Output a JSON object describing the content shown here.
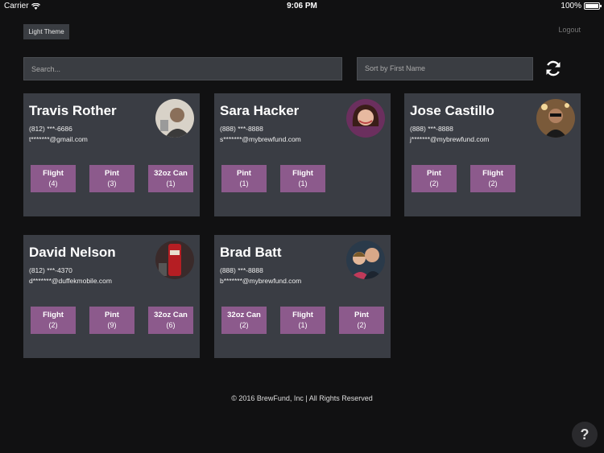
{
  "status": {
    "carrier": "Carrier",
    "time": "9:06 PM",
    "battery": "100%"
  },
  "header": {
    "theme_button": "Light Theme",
    "logout": "Logout"
  },
  "search": {
    "placeholder": "Search...",
    "sort_label": "Sort by First Name"
  },
  "cards": [
    {
      "name": "Travis Rother",
      "phone": "(812) ***-6686",
      "email": "t*******@gmail.com",
      "avatar_color": "#5a5a55",
      "drinks": [
        {
          "label": "Flight",
          "count": "(4)"
        },
        {
          "label": "Pint",
          "count": "(3)"
        },
        {
          "label": "32oz Can",
          "count": "(1)"
        }
      ]
    },
    {
      "name": "Sara Hacker",
      "phone": "(888) ***-8888",
      "email": "s*******@mybrewfund.com",
      "avatar_color": "#7a3a6a",
      "drinks": [
        {
          "label": "Pint",
          "count": "(1)"
        },
        {
          "label": "Flight",
          "count": "(1)"
        }
      ]
    },
    {
      "name": "Jose Castillo",
      "phone": "(888) ***-8888",
      "email": "j*******@mybrewfund.com",
      "avatar_color": "#6a5040",
      "drinks": [
        {
          "label": "Pint",
          "count": "(2)"
        },
        {
          "label": "Flight",
          "count": "(2)"
        }
      ]
    },
    {
      "name": "David Nelson",
      "phone": "(812) ***-4370",
      "email": "d*******@duffekmobile.com",
      "avatar_color": "#7a2a2a",
      "drinks": [
        {
          "label": "Flight",
          "count": "(2)"
        },
        {
          "label": "Pint",
          "count": "(9)"
        },
        {
          "label": "32oz Can",
          "count": "(6)"
        }
      ]
    },
    {
      "name": "Brad Batt",
      "phone": "(888) ***-8888",
      "email": "b*******@mybrewfund.com",
      "avatar_color": "#3a4a5a",
      "drinks": [
        {
          "label": "32oz Can",
          "count": "(2)"
        },
        {
          "label": "Flight",
          "count": "(1)"
        },
        {
          "label": "Pint",
          "count": "(2)"
        }
      ]
    }
  ],
  "footer": {
    "copyright": "© 2016 BrewFund, Inc | All Rights Reserved"
  },
  "colors": {
    "background": "#111112",
    "card": "#3a3d44",
    "drink_button": "#8c5a8c"
  }
}
